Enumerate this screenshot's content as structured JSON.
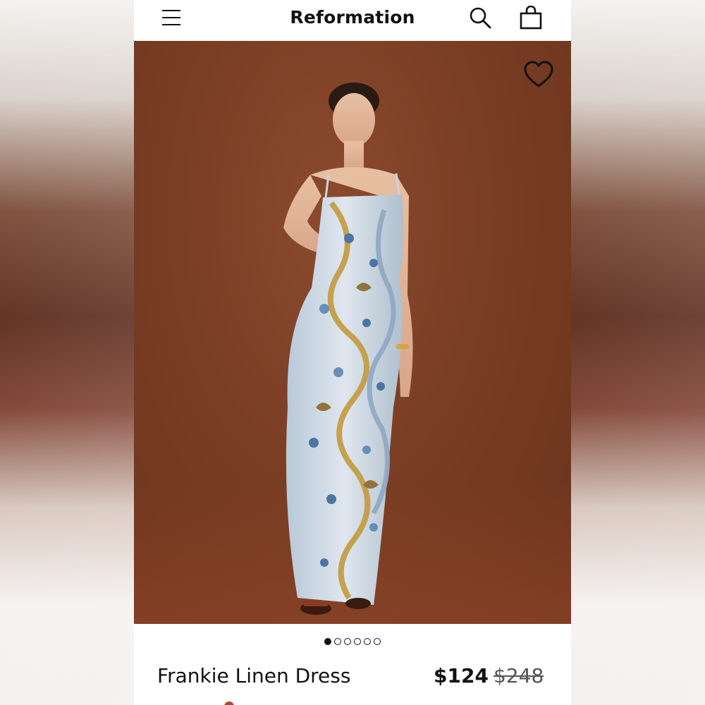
{
  "header": {
    "brand": "Reformation",
    "icons": [
      "menu-icon",
      "search-icon",
      "bag-icon"
    ]
  },
  "hero": {
    "icons": [
      "heart-icon"
    ],
    "background_color": "#7a3e24"
  },
  "carousel": {
    "total": 6,
    "active_index": 0
  },
  "product": {
    "name": "Frankie Linen Dress",
    "price": "$124",
    "original_price": "$248"
  },
  "colors": {
    "text": "#111111",
    "swatch": "#b8452c"
  }
}
